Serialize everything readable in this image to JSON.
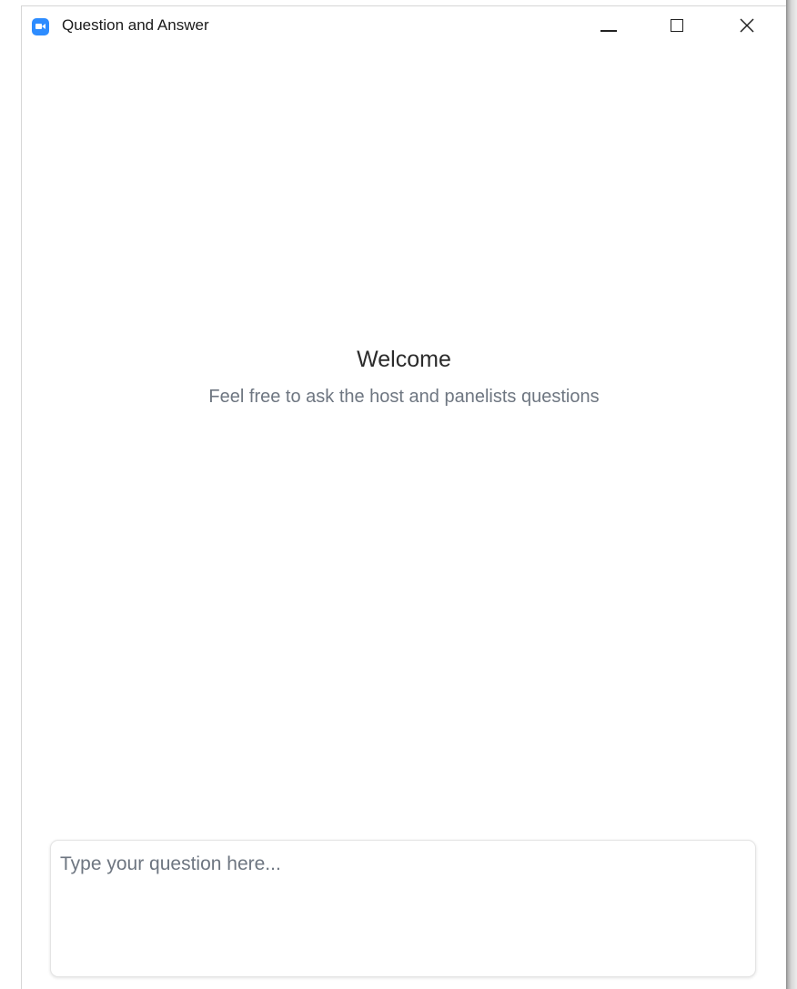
{
  "window": {
    "title": "Question and Answer",
    "icon": "zoom-camera-icon",
    "accent_color": "#2D8CFF"
  },
  "controls": {
    "minimize": "minimize-icon",
    "maximize": "maximize-icon",
    "close": "close-icon"
  },
  "welcome": {
    "title": "Welcome",
    "subtitle": "Feel free to ask the host and panelists questions"
  },
  "question_input": {
    "value": "",
    "placeholder": "Type your question here..."
  }
}
